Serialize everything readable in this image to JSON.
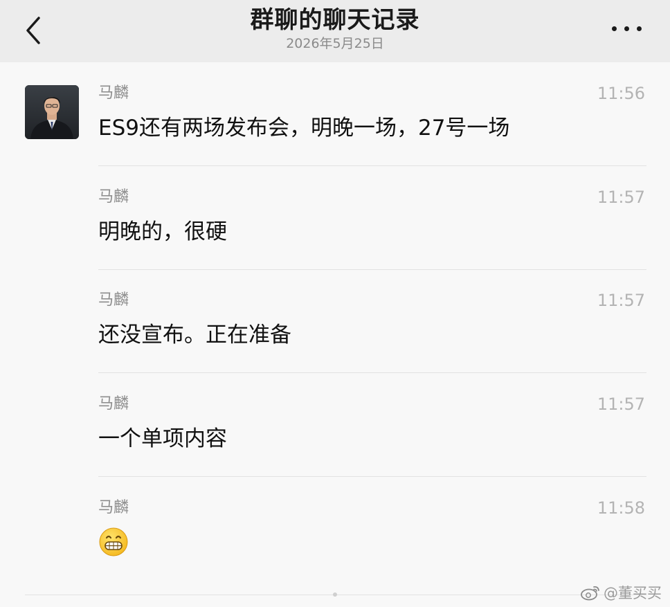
{
  "header": {
    "title": "群聊的聊天记录",
    "date": "2026年5月25日"
  },
  "messages": [
    {
      "sender": "马麟",
      "time": "11:56",
      "text": "ES9还有两场发布会，明晚一场，27号一场"
    },
    {
      "sender": "马麟",
      "time": "11:57",
      "text": "明晚的，很硬"
    },
    {
      "sender": "马麟",
      "time": "11:57",
      "text": "还没宣布。正在准备"
    },
    {
      "sender": "马麟",
      "time": "11:57",
      "text": "一个单项内容"
    },
    {
      "sender": "马麟",
      "time": "11:58",
      "emoji": "grinning-face-emoji"
    }
  ],
  "watermark": {
    "text": "@董买买",
    "icon": "weibo-icon"
  },
  "icons": {
    "back": "chevron-left-icon",
    "more": "more-dots-icon"
  },
  "colors": {
    "header_bg": "#ececec",
    "page_bg": "#f8f8f8",
    "emoji_yellow": "#f6c12a"
  }
}
